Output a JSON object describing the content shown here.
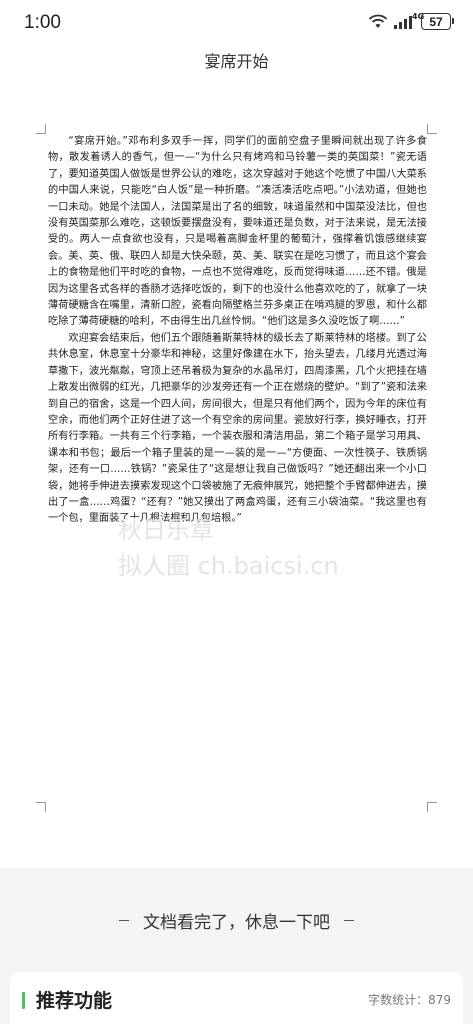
{
  "status_bar": {
    "time": "1:00",
    "network": "4G",
    "battery": "57"
  },
  "document": {
    "title": "宴席开始",
    "paragraphs": [
      "“宴席开始。”邓布利多双手一挥，同学们的面前空盘子里瞬间就出现了许多食物，散发着诱人的香气，但一—“为什么只有烤鸡和马铃薯一类的英国菜！”瓷无语了，要知道英国人做饭是世界公认的难吃，这次穿越对于她这个吃惯了中国八大菜系的中国人来说，只能吃“白人饭”是一种折磨。“凑活凑活吃点吧。”小法劝道，但她也一口未动。她是个法国人，法国菜是出了名的细致，味道虽然和中国菜没法比，但也没有英国菜那么难吃，这顿饭要摆盘没有，要味道还是负数，对于法来说，是无法接受的。两人一点食欲也没有，只是喝着高脚金杯里的葡萄汁，强撑着饥饿感继续宴会。美、英、俄、联四人却是大快朵颐，英、美、联实在是吃习惯了，而且这个宴会上的食物是他们平时吃的食物，一点也不觉得难吃，反而觉得味道……还不错。俄是因为这里各式各样的香肠才选择吃饭的，剩下的也没什么他喜欢吃的了，就拿了一块薄荷硬糖含在嘴里，清新口腔，瓷看向隔壁格兰芬多桌正在啃鸡腿的罗恩，和什么都吃除了薄荷硬糖的哈利，不由得生出几丝怜悯。“他们这是多久没吃饭了啊……”",
      "欢迎宴会结束后，他们五个跟随着斯莱特林的级长去了斯莱特林的塔楼。到了公共休息室，休息室十分豪华和神秘，这里好像建在水下，抬头望去，几缕月光透过海草撒下，波光粼粼，穹顶上还吊着极为复杂的水晶吊灯，四周漆黑，几个火把挂在墙上散发出微弱的红光，几把豪华的沙发旁还有一个正在燃烧的壁炉。“到了”瓷和法来到自己的宿舍，这是一个四人间，房间很大，但是只有他们两个，因为今年的床位有空余，而他们两个正好住进了这一个有空余的房间里。瓷放好行李，换好睡衣，打开所有行李箱。一共有三个行李箱，一个装衣服和清洁用品，第二个箱子是学习用具、课本和书包；最后一个箱子里装的是一—装的是一—“方便面、一次性筷子、铁质锅架，还有一口……铁锅？”瓷呆住了“这是想让我自己做饭吗？”她还翻出来一个小口袋，她将手伸进去摸索发现这个口袋被施了无痕伸展咒，她把整个手臂都伸进去，摸出了一盒……鸡蛋？“还有？”她又摸出了两盒鸡蛋，还有三小袋油菜。“我这里也有一个包，里面装了十几根法棍和几包培根。”"
    ],
    "watermark_line1": "秋日乐章",
    "watermark_line2": "拟人圈 ch.baicsi.cn"
  },
  "bottom": {
    "end_message": "文档看完了，休息一下吧",
    "recommend_title": "推荐功能",
    "word_count": "字数统计：879"
  },
  "colors": {
    "accent_green": "#4cc35a",
    "panel_bg": "#f4f4f4"
  },
  "icons": [
    "wifi-icon",
    "signal-icon",
    "battery-icon"
  ]
}
